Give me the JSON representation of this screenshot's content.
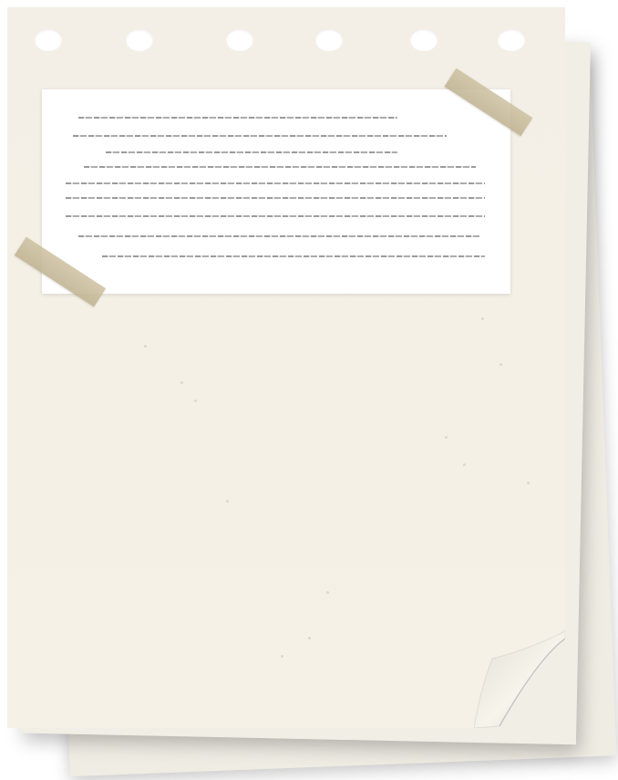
{
  "canvas": {
    "background": "#ffffff"
  },
  "notepad": {
    "paper_color": "#f4f0e5",
    "card_color": "#ffffff",
    "tape_color": "#c9bc9c",
    "ring_hole_count": 6,
    "note_line_count": 9
  }
}
